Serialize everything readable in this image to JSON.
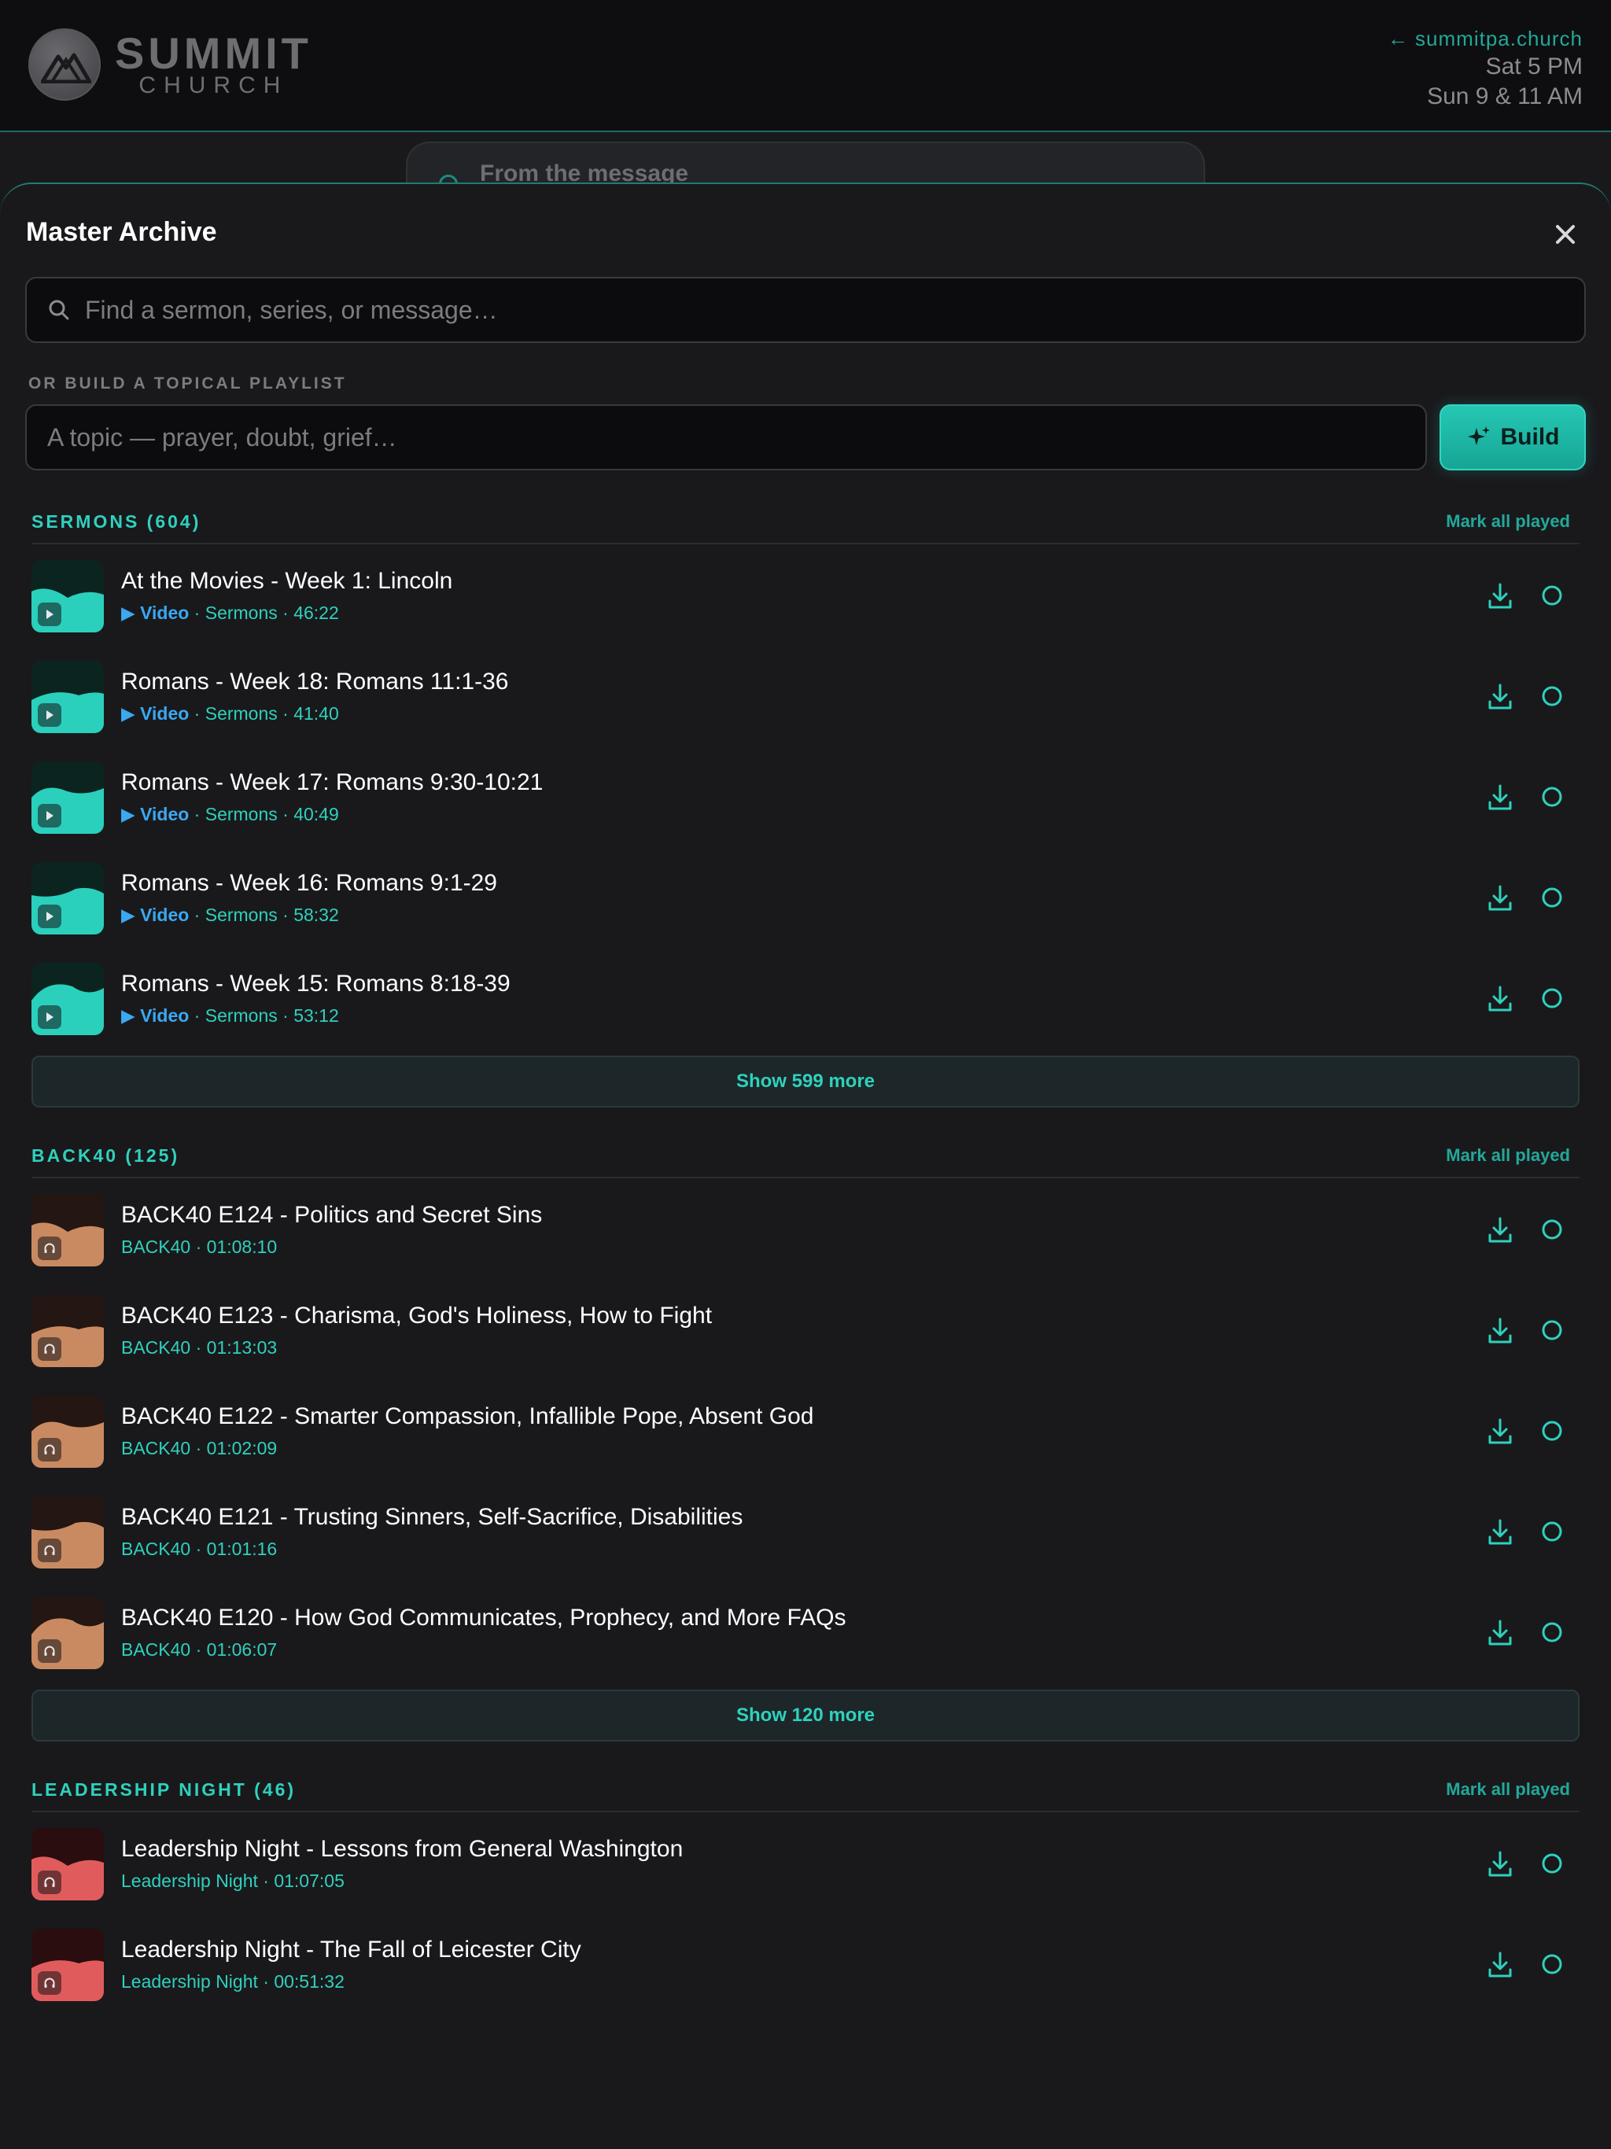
{
  "header": {
    "logo_word": "SUMMIT",
    "logo_sub": "CHURCH",
    "site_link": "← summitpa.church",
    "times": [
      "Sat 5 PM",
      "Sun 9 & 11 AM"
    ]
  },
  "background_card": {
    "title": "From the message"
  },
  "sheet": {
    "title": "Master Archive",
    "search_placeholder": "Find a sermon, series, or message…",
    "playlist_label": "OR BUILD A TOPICAL PLAYLIST",
    "topic_placeholder": "A topic — prayer, doubt, grief…",
    "build_label": "Build"
  },
  "colors": {
    "accent": "#2fd1bd",
    "video": "#3ba8f0",
    "sermon_thumb": "#2ad0bc",
    "back40_thumb": "#c98a62",
    "leadership_thumb": "#e05c5c"
  },
  "sections": [
    {
      "title": "SERMONS (604)",
      "mark_label": "Mark all played",
      "show_more": "Show 599 more",
      "items": [
        {
          "title": "At the Movies - Week 1: Lincoln",
          "video": "▶ Video",
          "meta": " · Sermons · 46:22",
          "icon": "play-icon"
        },
        {
          "title": "Romans - Week 18: Romans 11:1-36",
          "video": "▶ Video",
          "meta": " · Sermons · 41:40",
          "icon": "play-icon"
        },
        {
          "title": "Romans - Week 17: Romans 9:30-10:21",
          "video": "▶ Video",
          "meta": " · Sermons · 40:49",
          "icon": "play-icon"
        },
        {
          "title": "Romans - Week 16: Romans 9:1-29",
          "video": "▶ Video",
          "meta": " · Sermons · 58:32",
          "icon": "play-icon"
        },
        {
          "title": "Romans - Week 15: Romans 8:18-39",
          "video": "▶ Video",
          "meta": " · Sermons · 53:12",
          "icon": "play-icon"
        }
      ]
    },
    {
      "title": "BACK40 (125)",
      "mark_label": "Mark all played",
      "show_more": "Show 120 more",
      "items": [
        {
          "title": "BACK40 E124 - Politics and Secret Sins",
          "meta": "BACK40 · 01:08:10",
          "icon": "headphones-icon"
        },
        {
          "title": "BACK40 E123 - Charisma, God's Holiness, How to Fight",
          "meta": "BACK40 · 01:13:03",
          "icon": "headphones-icon"
        },
        {
          "title": "BACK40 E122 - Smarter Compassion, Infallible Pope, Absent God",
          "meta": "BACK40 · 01:02:09",
          "icon": "headphones-icon"
        },
        {
          "title": "BACK40 E121 - Trusting Sinners, Self-Sacrifice, Disabilities",
          "meta": "BACK40 · 01:01:16",
          "icon": "headphones-icon"
        },
        {
          "title": "BACK40 E120 - How God Communicates, Prophecy, and More FAQs",
          "meta": "BACK40 · 01:06:07",
          "icon": "headphones-icon"
        }
      ]
    },
    {
      "title": "LEADERSHIP NIGHT (46)",
      "mark_label": "Mark all played",
      "items": [
        {
          "title": "Leadership Night - Lessons from General Washington",
          "meta": "Leadership Night · 01:07:05",
          "icon": "headphones-icon"
        },
        {
          "title": "Leadership Night - The Fall of Leicester City",
          "meta": "Leadership Night · 00:51:32",
          "icon": "headphones-icon"
        }
      ]
    }
  ]
}
